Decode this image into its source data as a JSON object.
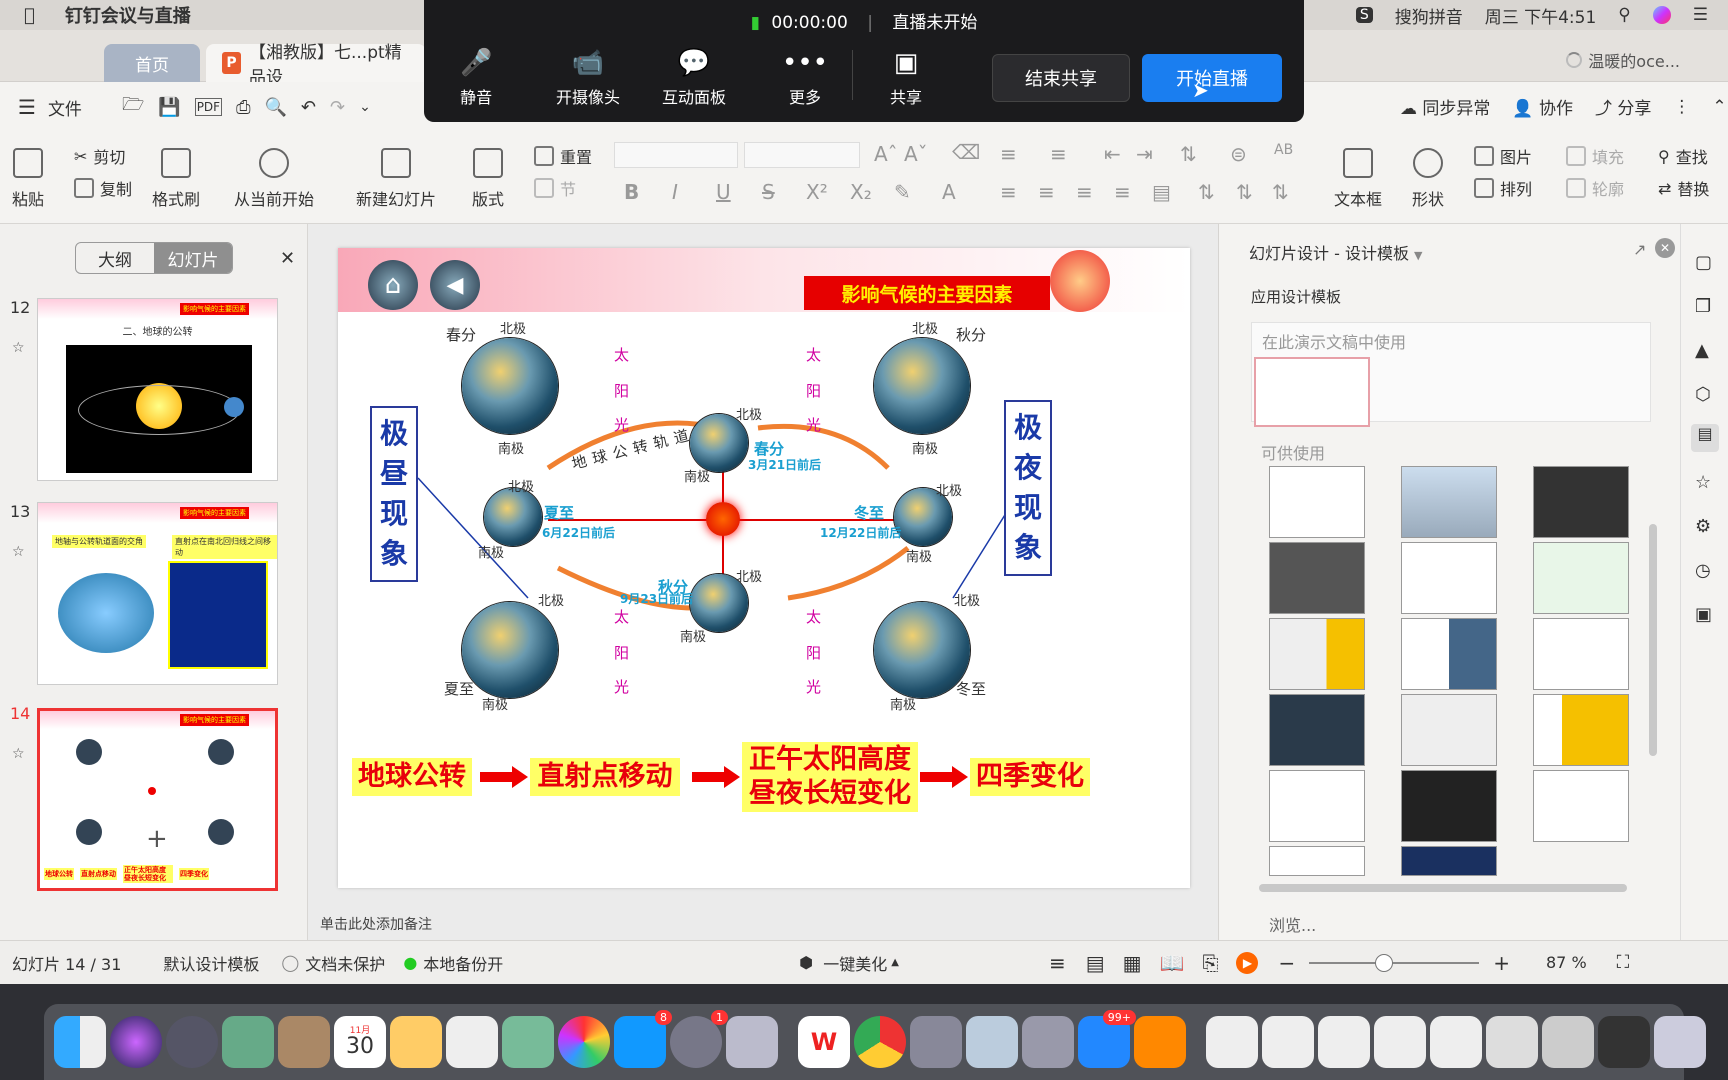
{
  "menubar": {
    "app": "钉钉会议与直播",
    "ime": "搜狗拼音",
    "clock": "周三 下午4:51"
  },
  "tabs": {
    "home": "首页",
    "doc": "【湘教版】七...pt精品设"
  },
  "user": "温暖的oce...",
  "toolbar": {
    "file": "文件",
    "sync": "同步异常",
    "collab": "协作",
    "share": "分享"
  },
  "dingtalk": {
    "timer": "00:00:00",
    "live_status": "直播未开始",
    "mute": "静音",
    "camera": "开摄像头",
    "board": "互动面板",
    "more": "更多",
    "share": "共享",
    "end_share": "结束共享",
    "start_live": "开始直播"
  },
  "ribbon": {
    "paste": "粘贴",
    "cut": "剪切",
    "copy": "复制",
    "format_painter": "格式刷",
    "play_from_current": "从当前开始",
    "new_slide": "新建幻灯片",
    "layout": "版式",
    "reset": "重置",
    "section": "节",
    "textbox": "文本框",
    "shape": "形状",
    "picture": "图片",
    "fill": "填充",
    "arrange": "排列",
    "outline": "轮廓",
    "find": "查找",
    "replace": "替换"
  },
  "left": {
    "outline": "大纲",
    "slides": "幻灯片",
    "thumbs": [
      {
        "num": "12",
        "banner": "影响气候的主要因素",
        "title": "二、地球的公转"
      },
      {
        "num": "13",
        "banner": "影响气候的主要因素",
        "title": "地轴与公转轨道面的交角",
        "title2": "直射点在南北回归线之间移动"
      },
      {
        "num": "14",
        "banner": "影响气候的主要因素",
        "flow": [
          "地球公转",
          "直射点移动",
          "正午太阳高度昼夜长短变化",
          "四季变化"
        ]
      }
    ]
  },
  "slide": {
    "banner": "影响气候的主要因素",
    "polar_day": "极昼现象",
    "polar_night": "极夜现象",
    "north": "北极",
    "south": "南极",
    "spring": "春分",
    "autumn": "秋分",
    "summer": "夏至",
    "winter": "冬至",
    "sunlight": [
      "太",
      "阳",
      "光"
    ],
    "orbit": "地球公转轨道",
    "spring_date": "3月21日前后",
    "summer_date": "6月22日前后",
    "autumn_date": "9月23日前后",
    "winter_date": "12月22日前后",
    "flow": [
      "地球公转",
      "直射点移动",
      "正午太阳高度",
      "昼夜长短变化",
      "四季变化"
    ]
  },
  "notes": "单击此处添加备注",
  "rightpane": {
    "title": "幻灯片设计 - 设计模板",
    "apply": "应用设计模板",
    "in_use": "在此演示文稿中使用",
    "available": "可供使用",
    "browse": "浏览..."
  },
  "status": {
    "slide": "幻灯片 14 / 31",
    "template": "默认设计模板",
    "protect": "文档未保护",
    "backup": "本地备份开",
    "beautify": "一键美化",
    "zoom": "87 %"
  },
  "dock": {
    "cal_month": "11月",
    "cal_day": "30",
    "badge_app": "8",
    "badge_settings": "1",
    "badge_qq": "99+"
  }
}
